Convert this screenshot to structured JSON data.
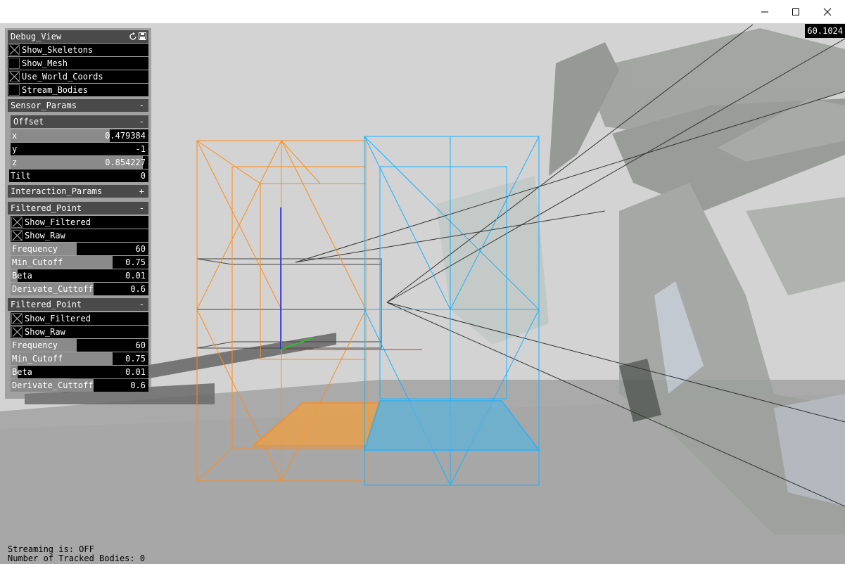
{
  "fps": "60.1024",
  "window_controls": {
    "minimize": "minimize-icon",
    "maximize": "maximize-icon",
    "close": "close-icon"
  },
  "debug_view": {
    "title": "Debug_View",
    "refresh_icon": "refresh-icon",
    "save_icon": "save-icon",
    "toggles": [
      {
        "label": "Show_Skeletons",
        "checked": true
      },
      {
        "label": "Show_Mesh",
        "checked": false
      },
      {
        "label": "Use_World_Coords",
        "checked": true
      },
      {
        "label": "Stream_Bodies",
        "checked": false
      }
    ]
  },
  "sensor_params": {
    "title": "Sensor_Params",
    "sign": "-",
    "offset": {
      "title": "Offset",
      "sign": "-",
      "x": {
        "label": "x",
        "value": "0.479384",
        "fill": 0.72
      },
      "y": {
        "label": "y",
        "value": "-1",
        "fill": 0.0
      },
      "z": {
        "label": "z",
        "value": "0.854227",
        "fill": 0.96
      }
    },
    "tilt": {
      "label": "Tilt",
      "value": "0",
      "fill": 0.0
    }
  },
  "interaction_params": {
    "title": "Interaction_Params",
    "sign": "+"
  },
  "filtered_points": [
    {
      "title": "Filtered_Point",
      "sign": "-",
      "show_filtered": {
        "label": "Show_Filtered",
        "checked": true
      },
      "show_raw": {
        "label": "Show_Raw",
        "checked": true
      },
      "frequency": {
        "label": "Frequency",
        "value": "60",
        "fill": 0.48
      },
      "min_cutoff": {
        "label": "Min_Cutoff",
        "value": "0.75",
        "fill": 0.74
      },
      "beta": {
        "label": "Beta",
        "value": "0.01",
        "fill": 0.05
      },
      "derivate_cutoff": {
        "label": "Derivate_Cuttoff",
        "value": "0.6",
        "fill": 0.6
      }
    },
    {
      "title": "Filtered_Point",
      "sign": "-",
      "show_filtered": {
        "label": "Show_Filtered",
        "checked": true
      },
      "show_raw": {
        "label": "Show_Raw",
        "checked": true
      },
      "frequency": {
        "label": "Frequency",
        "value": "60",
        "fill": 0.48
      },
      "min_cutoff": {
        "label": "Min_Cutoff",
        "value": "0.75",
        "fill": 0.74
      },
      "beta": {
        "label": "Beta",
        "value": "0.01",
        "fill": 0.05
      },
      "derivate_cutoff": {
        "label": "Derivate_Cuttoff",
        "value": "0.6",
        "fill": 0.6
      }
    }
  ],
  "status": {
    "streaming": "Streaming is: OFF",
    "tracked_bodies": "Number of Tracked Bodies: 0"
  },
  "colors": {
    "orange_zone": "#ff8c1a",
    "blue_zone": "#1ab2ff",
    "panel_bg": "#000000",
    "viewport_bg": "#d3d3d3"
  }
}
